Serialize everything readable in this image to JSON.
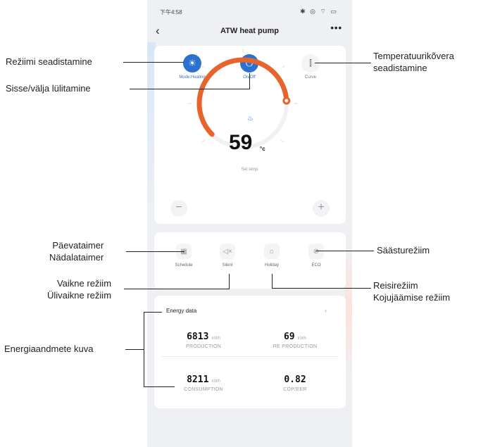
{
  "status_bar": {
    "time": "下午4:58",
    "icons": "✱ ◎ ⌔ ▭"
  },
  "nav": {
    "back_icon": "‹",
    "title": "ATW heat pump",
    "more_icon": "•••"
  },
  "top_buttons": {
    "mode": {
      "label": "Mode:Heating",
      "icon": "☀"
    },
    "power": {
      "label": "On/Off",
      "icon": "⏻"
    },
    "curve": {
      "label": "Curve",
      "icon": "⫿"
    }
  },
  "dial": {
    "set_temp_value": "59",
    "unit": "°c",
    "label": "Set temp",
    "heat_icon": "♨",
    "progress_fraction": 0.82
  },
  "controls": {
    "minus": "−",
    "plus": "+"
  },
  "functions": [
    {
      "label": "Schedule",
      "icon": "▦"
    },
    {
      "label": "Silent",
      "icon": "◁×"
    },
    {
      "label": "Holiday",
      "icon": "⌂"
    },
    {
      "label": "ECO",
      "icon": "⊘"
    }
  ],
  "energy": {
    "title": "Energy data",
    "chevron": "›",
    "production": {
      "value": "6813",
      "unit": "kWh",
      "label": "PRODUCTION"
    },
    "re_production": {
      "value": "69",
      "unit": "kWh",
      "label": "RE PRODUCTION"
    },
    "consumption": {
      "value": "8211",
      "unit": "kWh",
      "label": "CONSUMPTION"
    },
    "cop": {
      "value": "0.82",
      "label": "COP/EER"
    }
  },
  "annotations": {
    "mode": "Režiimi seadistamine",
    "power": "Sisse/välja lülitamine",
    "curve": "Temperatuurikõvera\nseadistamine",
    "timer": "Päevataimer\nNädalataimer",
    "eco": "Säästurežiim",
    "silent": "Vaikne režiim\nÜlivaikne režiim",
    "holiday": "Reisirežiim\nKojujäämise režiim",
    "energy": "Energiaandmete kuva"
  }
}
